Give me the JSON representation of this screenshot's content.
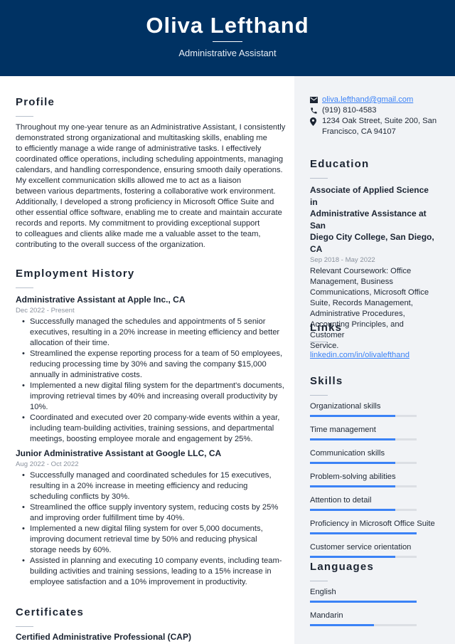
{
  "header": {
    "name": "Oliva Lefthand",
    "title": "Administrative Assistant",
    "bg_color": "#003263"
  },
  "profile": {
    "heading": "Profile",
    "lines": [
      "Throughout my one-year tenure as an Administrative Assistant, I consistently",
      "demonstrated strong organizational and multitasking skills, enabling me",
      "to efficiently manage a wide range of administrative tasks. I effectively",
      "coordinated office operations, including scheduling appointments, managing",
      "calendars, and handling correspondence, ensuring smooth daily operations.",
      "My excellent communication skills allowed me to act as a liaison",
      "between various departments, fostering a collaborative work environment.",
      "Additionally, I developed a strong proficiency in Microsoft Office Suite and",
      "other essential office software, enabling me to create and maintain accurate",
      "records and reports. My commitment to providing exceptional support",
      "to colleagues and clients alike made me a valuable asset to the team,",
      "contributing to the overall success of the organization."
    ]
  },
  "employment": {
    "heading": "Employment History",
    "jobs": [
      {
        "title": "Administrative Assistant at Apple Inc., CA",
        "dates": "Dec 2022 - Present",
        "bullets": [
          "Successfully managed the schedules and appointments of 5 senior executives, resulting in a 20% increase in meeting efficiency and better allocation of their time.",
          "Streamlined the expense reporting process for a team of 50 employees, reducing processing time by 30% and saving the company $15,000 annually in administrative costs.",
          "Implemented a new digital filing system for the department's documents, improving retrieval times by 40% and increasing overall productivity by 10%.",
          "Coordinated and executed over 20 company-wide events within a year, including team-building activities, training sessions, and departmental meetings, boosting employee morale and engagement by 25%."
        ]
      },
      {
        "title": "Junior Administrative Assistant at Google LLC, CA",
        "dates": "Aug 2022 - Oct 2022",
        "bullets": [
          "Successfully managed and coordinated schedules for 15 executives, resulting in a 20% increase in meeting efficiency and reducing scheduling conflicts by 30%.",
          "Streamlined the office supply inventory system, reducing costs by 25% and improving order fulfillment time by 40%.",
          "Implemented a new digital filing system for over 5,000 documents, improving document retrieval time by 50% and reducing physical storage needs by 60%.",
          "Assisted in planning and executing 10 company events, including team-building activities and training sessions, leading to a 15% increase in employee satisfaction and a 10% improvement in productivity."
        ]
      }
    ]
  },
  "certificates": {
    "heading": "Certificates",
    "items": [
      "Certified Administrative Professional (CAP)"
    ]
  },
  "contact": {
    "email": "oliva.lefthand@gmail.com",
    "phone": "(919) 810-4583",
    "address_line1": "1234 Oak Street, Suite 200, San",
    "address_line2": "Francisco, CA 94107",
    "icons": [
      "envelope-icon",
      "phone-icon",
      "map-pin-icon"
    ]
  },
  "education": {
    "heading": "Education",
    "degree_lines": [
      "Associate of Applied Science in",
      "Administrative Assistance at San",
      "Diego City College, San Diego, CA"
    ],
    "dates": "Sep 2018 - May 2022",
    "coursework_lines": [
      "Relevant Coursework: Office",
      "Management, Business",
      "Communications, Microsoft Office",
      "Suite, Records Management,",
      "Administrative Procedures,",
      "Accounting Principles, and Customer",
      "Service."
    ]
  },
  "links": {
    "heading": "Links",
    "items": [
      "linkedin.com/in/olivalefthand"
    ]
  },
  "skills": {
    "heading": "Skills",
    "items": [
      {
        "label": "Organizational skills",
        "level": 0.8
      },
      {
        "label": "Time management",
        "level": 0.8
      },
      {
        "label": "Communication skills",
        "level": 0.8
      },
      {
        "label": "Problem-solving abilities",
        "level": 0.8
      },
      {
        "label": "Attention to detail",
        "level": 0.8
      },
      {
        "label": "Proficiency in Microsoft Office Suite",
        "level": 1.0
      },
      {
        "label": "Customer service orientation",
        "level": 0.8
      }
    ]
  },
  "languages": {
    "heading": "Languages",
    "items": [
      {
        "label": "English",
        "level": 1.0
      },
      {
        "label": "Mandarin",
        "level": 0.6
      }
    ]
  },
  "colors": {
    "accent": "#3b82f6",
    "sidebar_bg": "#f1f3f6"
  }
}
